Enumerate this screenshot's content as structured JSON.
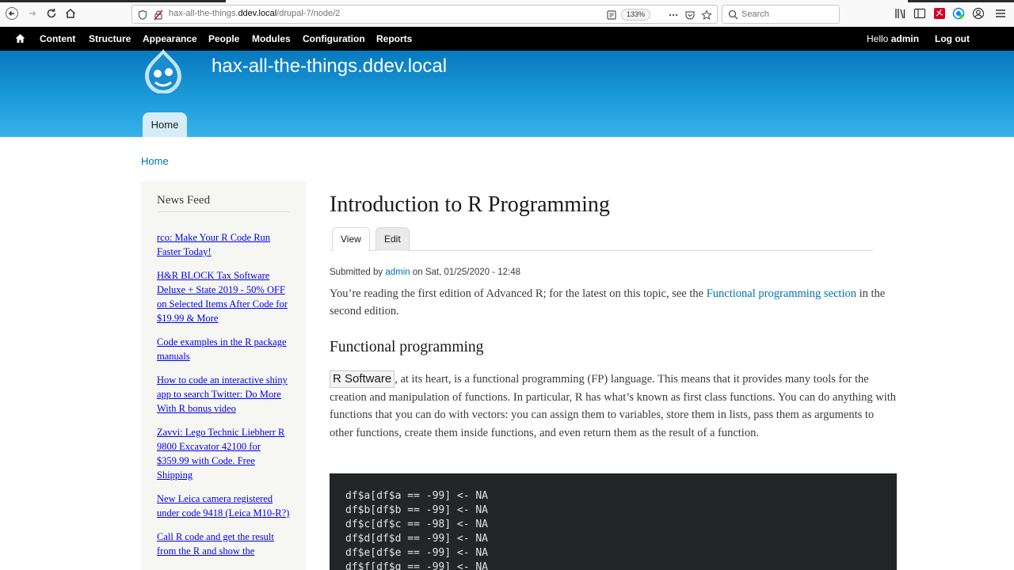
{
  "browser": {
    "url_prefix": "hax-all-the-things.",
    "url_domain": "ddev.local",
    "url_path": "/drupal-7/node/2",
    "zoom": "133%",
    "search_placeholder": "Search"
  },
  "admin_menu": {
    "items": [
      "Content",
      "Structure",
      "Appearance",
      "People",
      "Modules",
      "Configuration",
      "Reports"
    ],
    "greeting_prefix": "Hello ",
    "user": "admin",
    "logout": "Log out"
  },
  "site": {
    "name": "hax-all-the-things.ddev.local",
    "home_tab": "Home"
  },
  "breadcrumb": "Home",
  "sidebar": {
    "title": "News Feed",
    "items": [
      "rco: Make Your R Code Run Faster Today!",
      "H&R BLOCK Tax Software Deluxe + State 2019 - 50% OFF on Selected Items After Code for $19.99 & More",
      "Code examples in the R package manuals",
      "How to code an interactive shiny app to search Twitter: Do More With R bonus video",
      "Zavvi: Lego Technic Liebherr R 9800 Excavator 42100 for $359.99 with Code. Free Shipping",
      "New Leica camera registered under code 9418 (Leica M10-R?)",
      "Call R code and get the result from the R and show the"
    ]
  },
  "node": {
    "title": "Introduction to R Programming",
    "tabs": [
      "View",
      "Edit"
    ],
    "submitted_prefix": "Submitted by ",
    "author": "admin",
    "submitted_suffix": " on Sat, 01/25/2020 - 12:48",
    "intro_before": "You’re reading the first edition of Advanced R; for the latest on this topic, see the ",
    "intro_link": "Functional programming section",
    "intro_after": " in the second edition.",
    "section_title": "Functional programming",
    "tag": "R Software",
    "body": ", at its heart, is a functional programming (FP) language. This means that it provides many tools for the creation and manipulation of functions. In particular, R has what’s known as first class functions. You can do anything with functions that you can do with vectors: you can assign them to variables, store them in lists, pass them as arguments to other functions, create them inside functions, and even return them as the result of a function.",
    "code": "df$a[df$a == -99] <- NA\ndf$b[df$b == -99] <- NA\ndf$c[df$c == -98] <- NA\ndf$d[df$d == -99] <- NA\ndf$e[df$e == -99] <- NA\ndf$f[df$g == -99] <- NA"
  }
}
